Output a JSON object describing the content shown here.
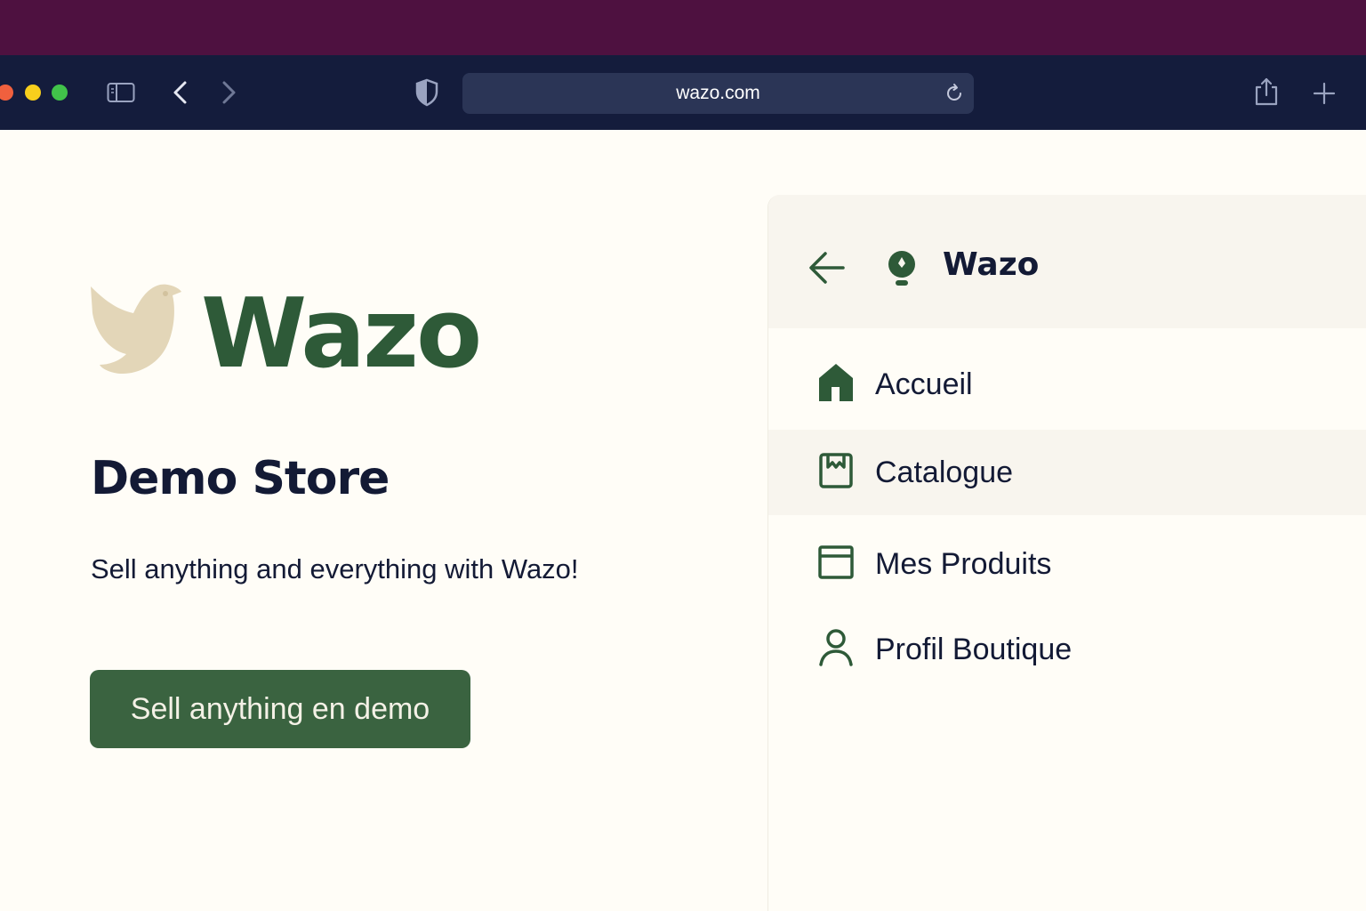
{
  "browser": {
    "url": "wazo.com",
    "icons": [
      "sidebar-icon",
      "back-icon",
      "forward-icon",
      "shield-icon",
      "reload-icon",
      "share-icon",
      "new-tab-icon"
    ]
  },
  "hero": {
    "logo_word": "Wazo",
    "store_title": "Demo Store",
    "tagline": "Sell anything and everything with Wazo!",
    "cta_label": "Sell anything en demo"
  },
  "panel": {
    "title": "Wazo",
    "items": [
      {
        "label": "Accueil",
        "icon": "home-icon",
        "active": false
      },
      {
        "label": "Catalogue",
        "icon": "catalogue-icon",
        "active": true
      },
      {
        "label": "Mes Produits",
        "icon": "products-icon",
        "active": false
      },
      {
        "label": "Profil Boutique",
        "icon": "profile-icon",
        "active": false
      }
    ]
  },
  "colors": {
    "brand_green": "#2e5a38",
    "button_green": "#3a6340",
    "toolbar": "#141c3c",
    "top_strip": "#4e1140",
    "page_bg": "#fffdf7",
    "logo_bird": "#e3d6b8"
  }
}
